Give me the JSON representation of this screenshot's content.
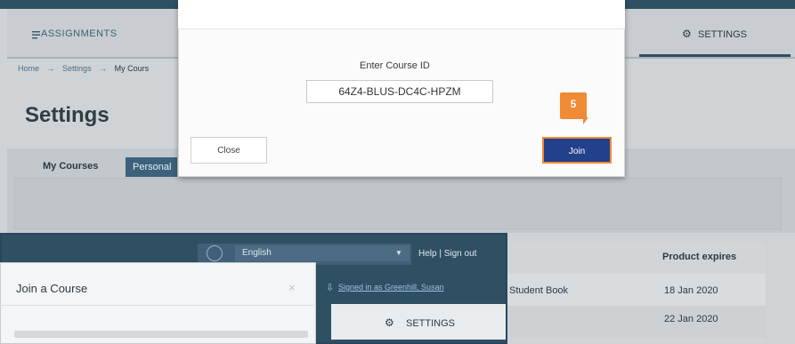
{
  "background": {
    "nav_assignments": "ASSIGNMENTS",
    "settings_tab": "SETTINGS",
    "breadcrumbs": [
      "Home",
      "→",
      "Settings",
      "→",
      "My Cours"
    ],
    "page_title": "Settings",
    "tabs": {
      "my_courses": "My Courses",
      "personal": "Personal"
    },
    "table": {
      "header_expires": "Product expires",
      "rows": [
        {
          "book": "Student Book",
          "expires": "18 Jan 2020"
        },
        {
          "book": "",
          "expires": "22 Jan 2020"
        }
      ]
    }
  },
  "modal": {
    "label": "Enter Course ID",
    "course_id_value": "64Z4-BLUS-DC4C-HPZM",
    "close_label": "Close",
    "join_label": "Join",
    "step_number": "5"
  },
  "overlay": {
    "language": "English",
    "help_signout": "Help  |  Sign out",
    "signed_in": "Signed in as Greenhill, Susan",
    "settings_tab": "SETTINGS",
    "join_course_title": "Join a Course",
    "close_symbol": "×"
  },
  "colors": {
    "brand_dark": "#2f4f63",
    "join_blue": "#23408a",
    "step_orange": "#f08a35"
  }
}
